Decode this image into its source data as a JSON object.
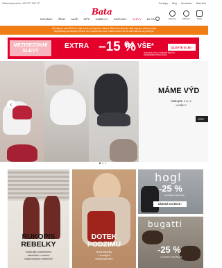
{
  "topstrip": {
    "left": "Zákaznický servis +420 577 005 177",
    "right": [
      "Prodejny",
      "Blog",
      "Newsletter",
      "Bata klub"
    ]
  },
  "header": {
    "logo": "Bata",
    "nav": [
      "NOVINKY",
      "ŽENY",
      "MUŽI",
      "DĚTI",
      "KABELKY",
      "DOPLŇKY",
      "SLEVY",
      "BLOG"
    ],
    "icons": [
      {
        "icon": "user-icon",
        "label": "Můj účet"
      },
      {
        "icon": "heart-icon",
        "label": "Oblíbené"
      },
      {
        "icon": "bag-icon",
        "label": "Košík"
      }
    ],
    "accent": "#e4002b"
  },
  "notice": {
    "line1": "Od nákupů nad 2000 Kč máte nárok na dopravu zdarma. Bata klub členové mají dopravu zdarma vždy.",
    "line2": "Objednávky doručujeme běžně do 3 pracovních dnů. Vrácení zboží do 30 dnů zdarma na prodejně."
  },
  "promo": {
    "season": "MEZISEZÓNNÍ SLEVY",
    "extra": "EXTRA",
    "percent": "–15 %",
    "na_vse": "NA VŠE*",
    "small": "*SLEVA PLATÍ NA VYBRANÉ ZBOŽÍ S OZNAČENÍM EXTRA SLEVA",
    "button": "ULOVTE SI JE ›",
    "color": "#e4002b"
  },
  "hero": {
    "title": "MÁME VÝD",
    "subtitle_1": "Nakupte c        e, v",
    "subtitle_2": "u nás n",
    "button": "VÍCE",
    "prev": "‹",
    "next": "›"
  },
  "tiles": {
    "t1": {
      "title_1": "RUKOPIS",
      "title_2": "REBELKY",
      "sub_1": "Vzdorujte podzimnímu",
      "sub_2": "nákladům v botách",
      "sub_3": "inspirovaných motorkáři"
    },
    "t2": {
      "title_1": "DOTEK",
      "title_2": "PODZIMU",
      "sub_1": "Nové kabelky",
      "sub_2": "v zemitých",
      "sub_3": "trendy barvách"
    },
    "t3": {
      "brand": "hogl",
      "pct": "-25 %",
      "small": "na produkty značky Högl",
      "button": "DÁMSKÁ KOLEKCE ›"
    },
    "t4": {
      "brand": "bugatti",
      "pct": "-25 %",
      "small": "na produkty značky Bugatti"
    }
  }
}
